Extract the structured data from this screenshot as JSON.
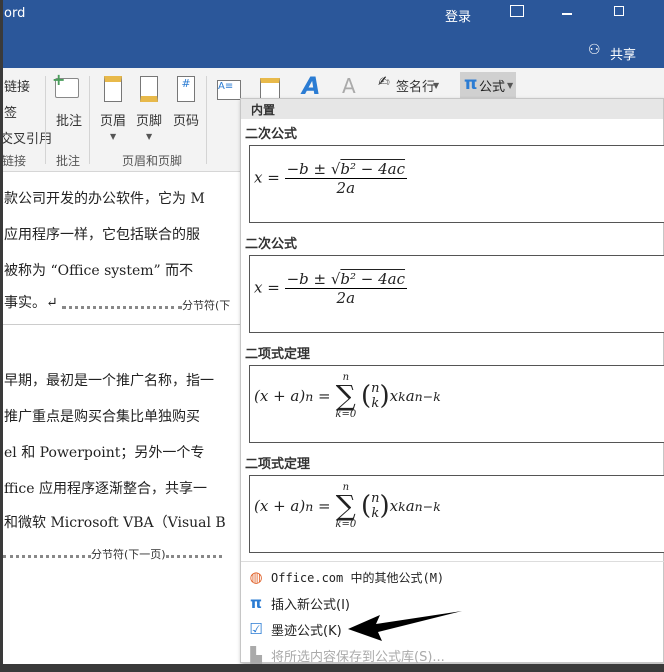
{
  "titlebar": {
    "app_fragment": "ord",
    "login": "登录",
    "share": "共享"
  },
  "ribbon": {
    "links_items": [
      "链接",
      "签",
      "交叉引用"
    ],
    "links_group": "链接",
    "comment_button": "批注",
    "comment_group": "批注",
    "header_button": "页眉",
    "footer_button": "页脚",
    "pagenum_button": "页码",
    "header_footer_group": "页眉和页脚",
    "signature_line": "签名行",
    "equation_button": "公式"
  },
  "document": {
    "lines": [
      "款公司开发的办公软件，它为 M",
      "应用程序一样，它包括联合的服",
      "被称为 “Office system” 而不",
      "事实。↵"
    ],
    "section_break_1": "分节符(下",
    "lines2": [
      "早期，最初是一个推广名称，指一",
      "推广重点是购买合集比单独购买",
      "el 和 Powerpoint；另外一个专",
      "ffice 应用程序逐渐整合，共享一",
      "和微软 Microsoft VBA（Visual B"
    ],
    "section_break_2": "分节符(下一页)"
  },
  "dropdown": {
    "header": "内置",
    "gallery": [
      {
        "title": "二次公式",
        "formula": "quadratic"
      },
      {
        "title": "二次公式",
        "formula": "quadratic"
      },
      {
        "title": "二项式定理",
        "formula": "binomial"
      },
      {
        "title": "二项式定理",
        "formula": "binomial"
      }
    ],
    "menu": [
      {
        "label": "Office.com 中的其他公式(M)",
        "icon": "office-globe-icon",
        "enabled": true
      },
      {
        "label": "插入新公式(I)",
        "icon": "pi-icon",
        "enabled": true
      },
      {
        "label": "墨迹公式(K)",
        "icon": "ink-equation-icon",
        "enabled": true
      },
      {
        "label": "将所选内容保存到公式库(S)...",
        "icon": "save-equation-icon",
        "enabled": false
      }
    ]
  }
}
